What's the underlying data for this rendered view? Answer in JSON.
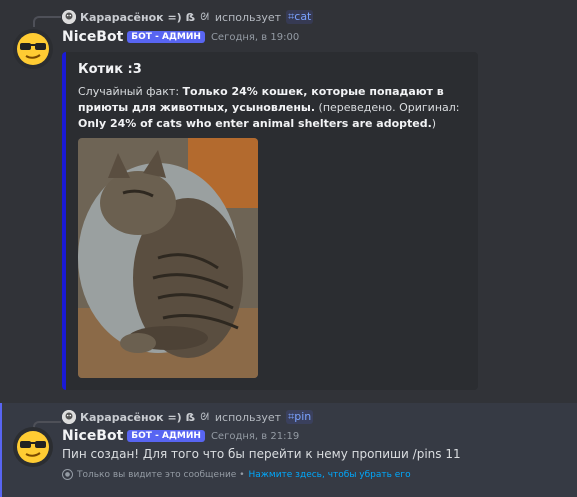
{
  "messages": [
    {
      "reply": {
        "author": "Карарасёнок =) ẞ",
        "emoji": "ᘛ",
        "verb": "использует",
        "channel_prefix": "⌗",
        "channel": "cat"
      },
      "author": "NiceBot",
      "badge": "БОТ - АДМИН",
      "timestamp": "Сегодня, в 19:00",
      "embed": {
        "title": "Котик :3",
        "desc_prefix": "Случайный факт: ",
        "fact_ru": "Только 24% кошек, которые попадают в приюты для животных, усыновлены.",
        "desc_mid": " (переведено. Оригинал: ",
        "fact_en": "Only 24% of cats who enter animal shelters are adopted.",
        "desc_suffix": ")",
        "accent_color": "#1a1ad6"
      }
    },
    {
      "reply": {
        "author": "Карарасёнок =) ẞ",
        "emoji": "ᘛ",
        "verb": "использует",
        "channel_prefix": "⌗",
        "channel": "pin"
      },
      "author": "NiceBot",
      "badge": "БОТ - АДМИН",
      "timestamp": "Сегодня, в 21:19",
      "text": "Пин создан! Для того что бы перейти к нему пропиши /pins 11",
      "ephemeral": {
        "note": "Только вы видите это сообщение •",
        "dismiss": "Нажмите здесь, чтобы убрать его"
      }
    }
  ],
  "colors": {
    "background": "#313338",
    "badge": "#5865f2",
    "link": "#00a8fc",
    "highlight": "#363a44"
  }
}
